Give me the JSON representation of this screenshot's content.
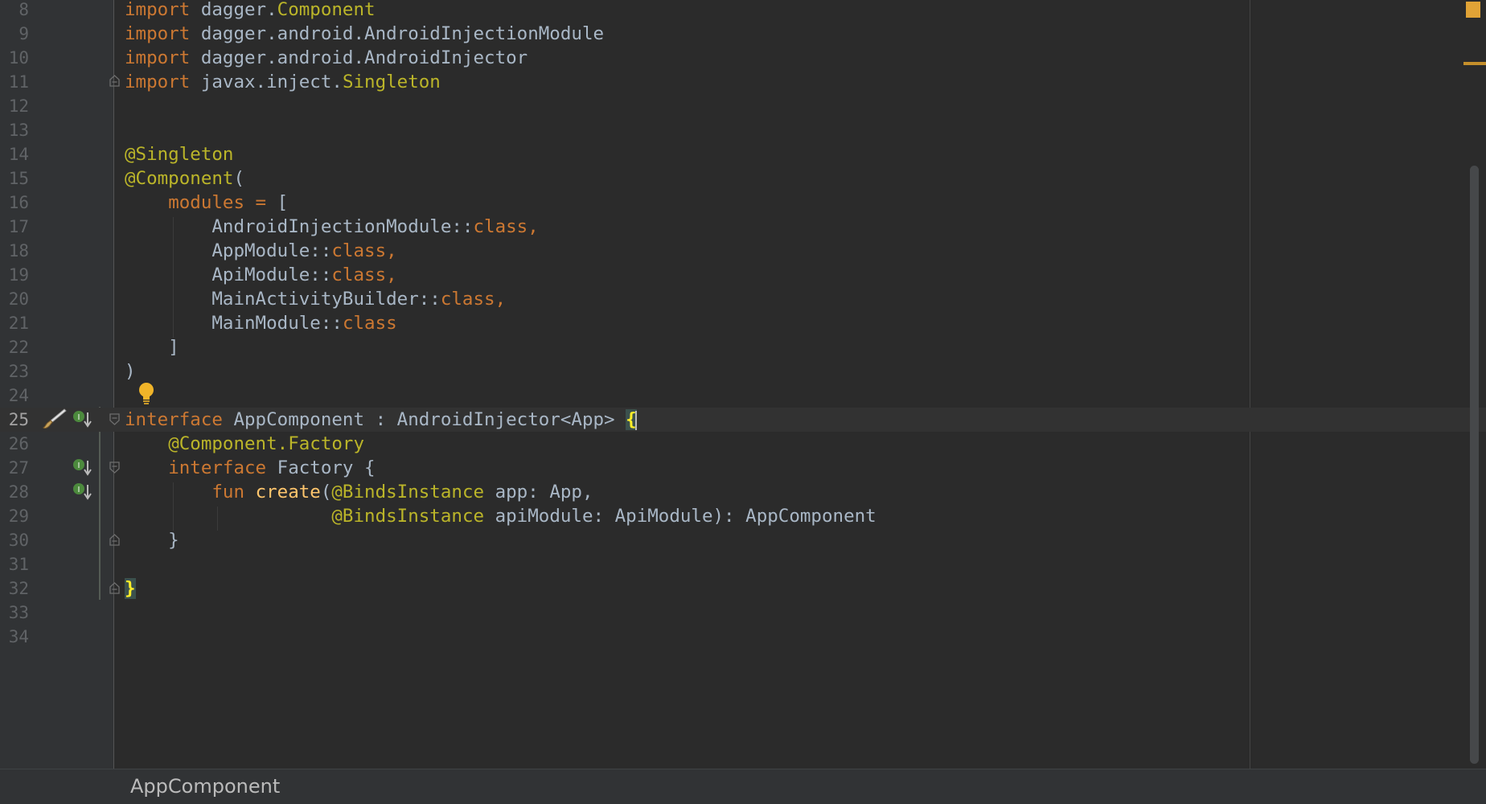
{
  "editor": {
    "lines": [
      {
        "n": "8",
        "tokens": [
          {
            "t": "import",
            "c": "kw"
          },
          {
            "t": " dagger.",
            "c": "plain"
          },
          {
            "t": "Component",
            "c": "ann"
          }
        ]
      },
      {
        "n": "9",
        "tokens": [
          {
            "t": "import",
            "c": "kw"
          },
          {
            "t": " dagger.android.AndroidInjectionModule",
            "c": "plain"
          }
        ]
      },
      {
        "n": "10",
        "tokens": [
          {
            "t": "import",
            "c": "kw"
          },
          {
            "t": " dagger.android.AndroidInjector",
            "c": "plain"
          }
        ]
      },
      {
        "n": "11",
        "tokens": [
          {
            "t": "import",
            "c": "kw"
          },
          {
            "t": " javax.inject.",
            "c": "plain"
          },
          {
            "t": "Singleton",
            "c": "ann"
          }
        ]
      },
      {
        "n": "12",
        "tokens": []
      },
      {
        "n": "13",
        "tokens": []
      },
      {
        "n": "14",
        "tokens": [
          {
            "t": "@Singleton",
            "c": "ann"
          }
        ]
      },
      {
        "n": "15",
        "tokens": [
          {
            "t": "@Component",
            "c": "ann"
          },
          {
            "t": "(",
            "c": "plain"
          }
        ]
      },
      {
        "n": "16",
        "tokens": [
          {
            "t": "    ",
            "c": "plain"
          },
          {
            "t": "modules = ",
            "c": "pn"
          },
          {
            "t": "[",
            "c": "plain"
          }
        ]
      },
      {
        "n": "17",
        "tokens": [
          {
            "t": "        AndroidInjectionModule::",
            "c": "plain"
          },
          {
            "t": "class,",
            "c": "kw"
          }
        ]
      },
      {
        "n": "18",
        "tokens": [
          {
            "t": "        AppModule::",
            "c": "plain"
          },
          {
            "t": "class,",
            "c": "kw"
          }
        ]
      },
      {
        "n": "19",
        "tokens": [
          {
            "t": "        ApiModule::",
            "c": "plain"
          },
          {
            "t": "class,",
            "c": "kw"
          }
        ]
      },
      {
        "n": "20",
        "tokens": [
          {
            "t": "        MainActivityBuilder::",
            "c": "plain"
          },
          {
            "t": "class,",
            "c": "kw"
          }
        ]
      },
      {
        "n": "21",
        "tokens": [
          {
            "t": "        MainModule::",
            "c": "plain"
          },
          {
            "t": "class",
            "c": "kw"
          }
        ]
      },
      {
        "n": "22",
        "tokens": [
          {
            "t": "    ]",
            "c": "plain"
          }
        ]
      },
      {
        "n": "23",
        "tokens": [
          {
            "t": ")",
            "c": "plain"
          }
        ]
      },
      {
        "n": "24",
        "tokens": []
      },
      {
        "n": "25",
        "current": true,
        "tokens": [
          {
            "t": "interface",
            "c": "kw"
          },
          {
            "t": " AppComponent : AndroidInjector<App> ",
            "c": "plain"
          },
          {
            "t": "{",
            "c": "brace-hl"
          }
        ]
      },
      {
        "n": "26",
        "tokens": [
          {
            "t": "    ",
            "c": "plain"
          },
          {
            "t": "@Component.Factory",
            "c": "ann"
          }
        ]
      },
      {
        "n": "27",
        "tokens": [
          {
            "t": "    ",
            "c": "plain"
          },
          {
            "t": "interface",
            "c": "kw"
          },
          {
            "t": " Factory {",
            "c": "plain"
          }
        ]
      },
      {
        "n": "28",
        "tokens": [
          {
            "t": "        ",
            "c": "plain"
          },
          {
            "t": "fun",
            "c": "kw"
          },
          {
            "t": " ",
            "c": "plain"
          },
          {
            "t": "create",
            "c": "fn"
          },
          {
            "t": "(",
            "c": "plain"
          },
          {
            "t": "@BindsInstance",
            "c": "ann"
          },
          {
            "t": " app: App,",
            "c": "plain"
          }
        ]
      },
      {
        "n": "29",
        "tokens": [
          {
            "t": "                   ",
            "c": "plain"
          },
          {
            "t": "@BindsInstance",
            "c": "ann"
          },
          {
            "t": " apiModule: ApiModule): AppComponent",
            "c": "plain"
          }
        ]
      },
      {
        "n": "30",
        "tokens": [
          {
            "t": "    }",
            "c": "plain"
          }
        ]
      },
      {
        "n": "31",
        "tokens": []
      },
      {
        "n": "32",
        "tokens": [
          {
            "t": "}",
            "c": "brace-hl"
          }
        ]
      },
      {
        "n": "33",
        "tokens": []
      },
      {
        "n": "34",
        "tokens": []
      }
    ],
    "colors": {
      "background": "#2b2b2b",
      "gutter": "#313335",
      "keyword": "#cc7832",
      "annotation": "#bbb529",
      "function": "#ffc66d",
      "text": "#a9b7c6",
      "line_number": "#606366"
    },
    "icons": {
      "intention": "lightbulb-icon",
      "vcs": "brush-icon",
      "implemented": "implemented-down-arrow-icon",
      "fold": "fold-marker-icon"
    }
  },
  "breadcrumb": {
    "item": "AppComponent"
  }
}
